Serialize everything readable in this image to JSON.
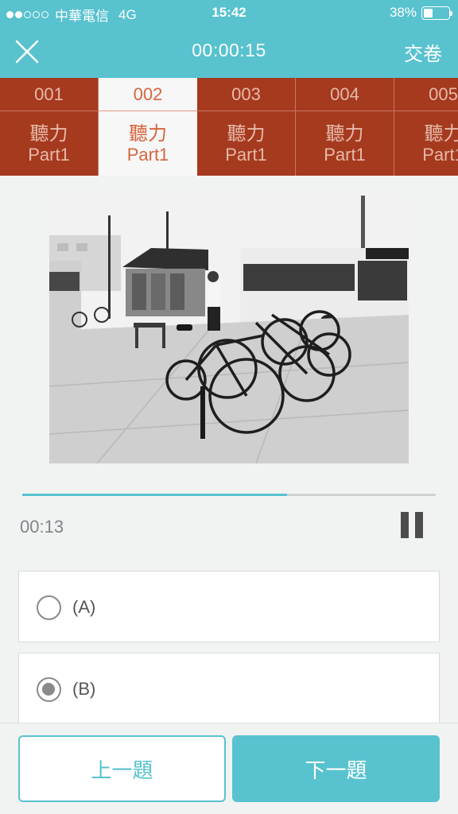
{
  "status_bar": {
    "carrier": "中華電信",
    "network": "4G",
    "time": "15:42",
    "battery_percent_text": "38%",
    "battery_level": 0.38,
    "signal_strength_dots": 2
  },
  "header": {
    "timer": "00:00:15",
    "submit_label": "交卷",
    "close_icon": "close-icon"
  },
  "tabs": [
    {
      "number": "001",
      "type": "聽力",
      "part": "Part1",
      "active": false
    },
    {
      "number": "002",
      "type": "聽力",
      "part": "Part1",
      "active": true
    },
    {
      "number": "003",
      "type": "聽力",
      "part": "Part1",
      "active": false
    },
    {
      "number": "004",
      "type": "聽力",
      "part": "Part1",
      "active": false
    },
    {
      "number": "005",
      "type": "聽力",
      "part": "Part1",
      "active": false
    }
  ],
  "audio": {
    "elapsed": "00:13",
    "progress": 0.64,
    "pause_icon": "pause-icon"
  },
  "options": [
    {
      "label": "(A)",
      "selected": false
    },
    {
      "label": "(B)",
      "selected": true
    }
  ],
  "footer": {
    "prev_label": "上一題",
    "next_label": "下一題"
  },
  "colors": {
    "primary": "#58c2cf",
    "tab_bg": "#a53a1f",
    "tab_active_text": "#d6653d"
  }
}
